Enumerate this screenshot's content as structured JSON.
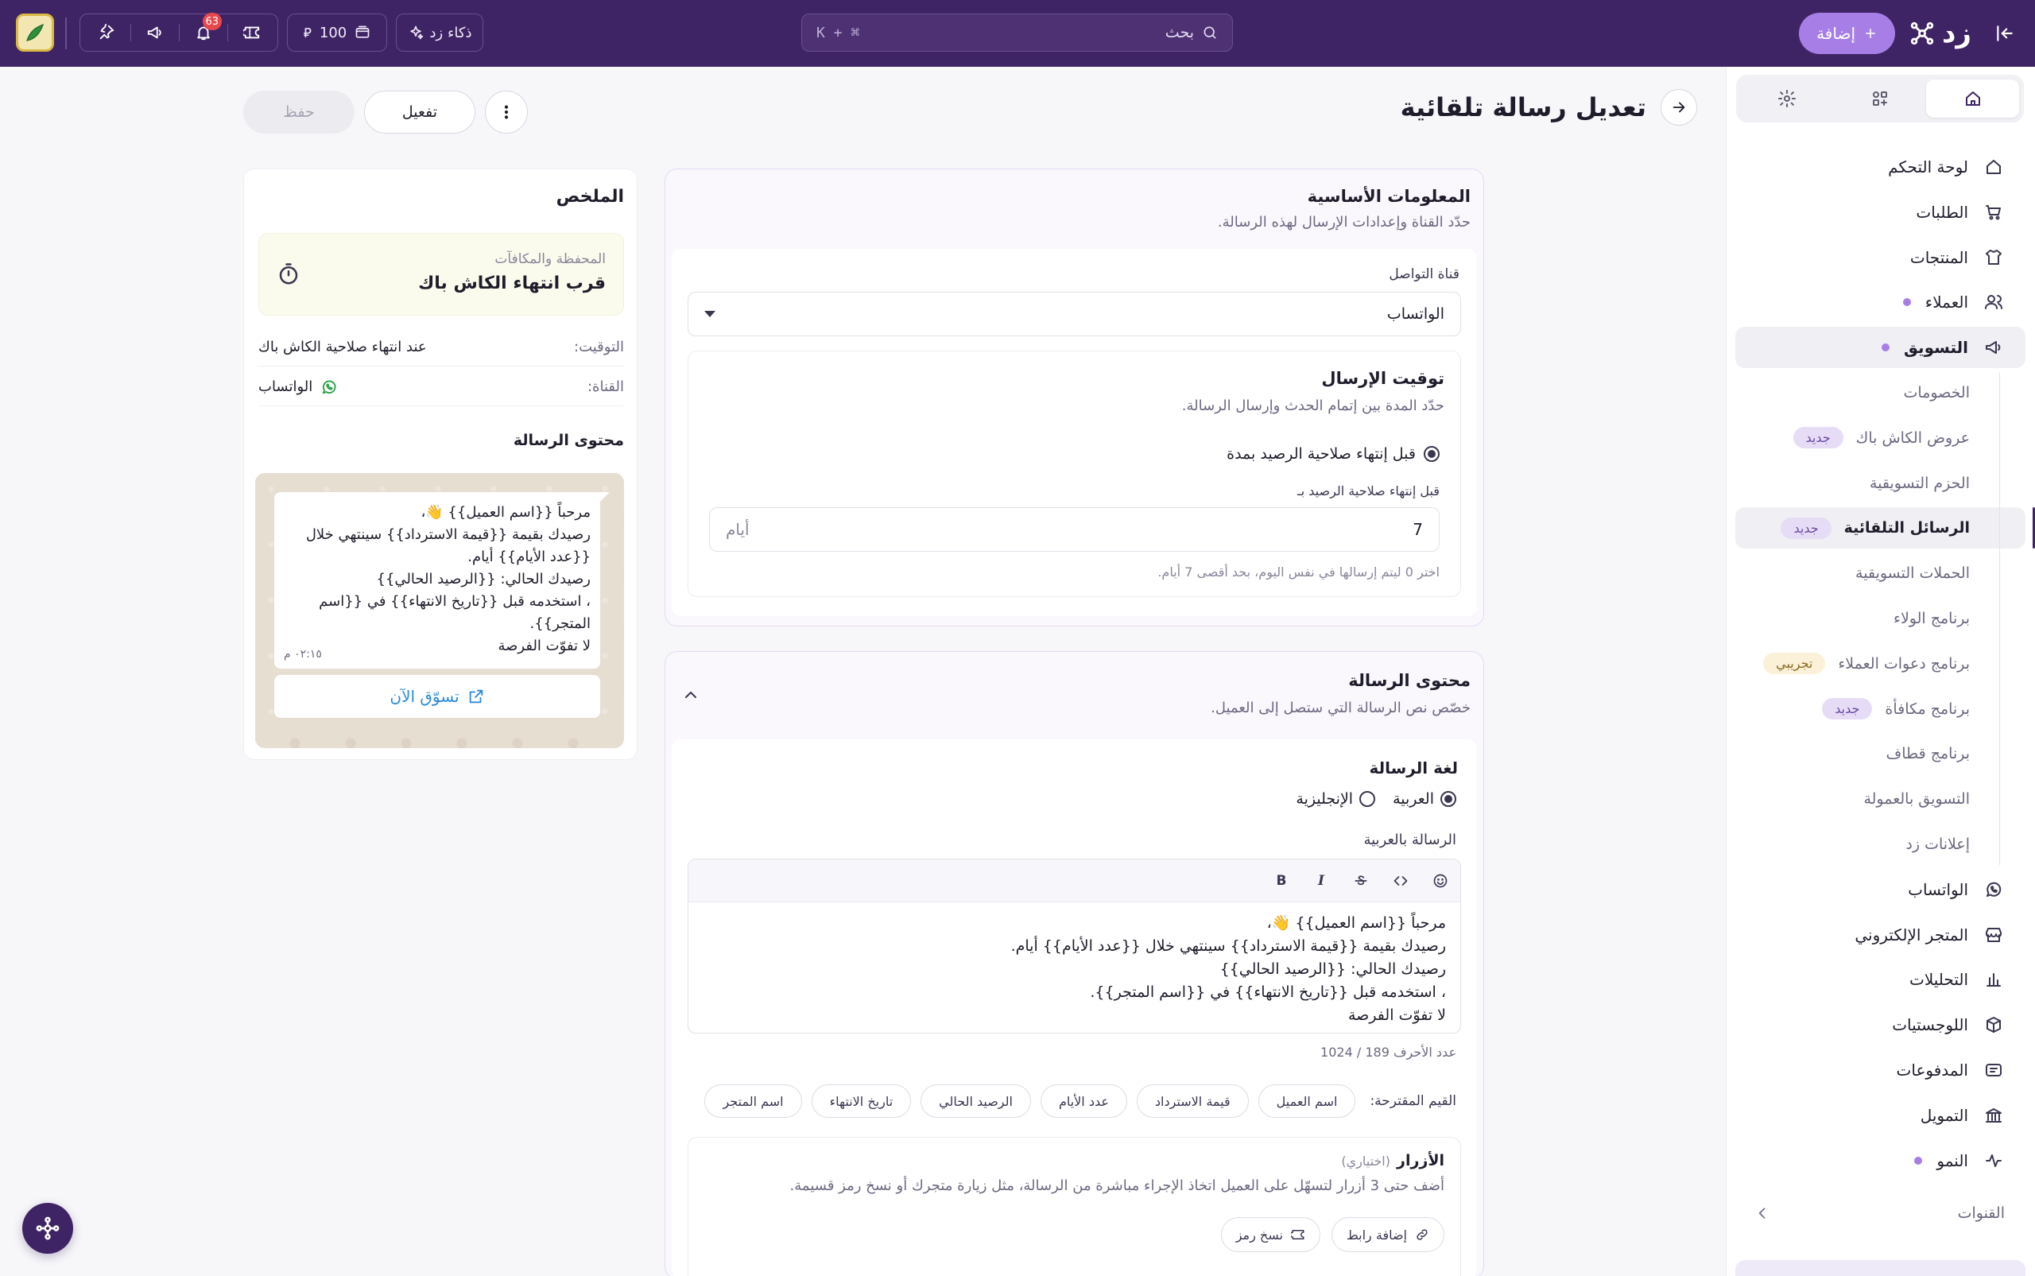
{
  "topbar": {
    "logo_text": "زد",
    "add_label": "إضافة",
    "search_placeholder": "بحث",
    "search_shortcut": "⌘ + K",
    "ai_label": "ذكاء زد",
    "balance": "100",
    "notifications_count": "63",
    "colors": {
      "bg": "#3f2465",
      "accent": "#a77ee6"
    }
  },
  "header": {
    "title": "تعديل رسالة تلقائية",
    "save_label": "حفظ",
    "activate_label": "تفعيل"
  },
  "sidebar": {
    "tabs": [
      "home-icon",
      "apps-icon",
      "settings-icon"
    ],
    "items": [
      {
        "label": "لوحة التحكم",
        "icon": "home-icon"
      },
      {
        "label": "الطلبات",
        "icon": "cart-icon"
      },
      {
        "label": "المنتجات",
        "icon": "shirt-icon"
      },
      {
        "label": "العملاء",
        "icon": "users-icon"
      },
      {
        "label": "التسويق",
        "icon": "megaphone-icon"
      }
    ],
    "marketing_sub": [
      {
        "label": "الخصومات"
      },
      {
        "label": "عروض الكاش باك",
        "badge": "جديد"
      },
      {
        "label": "الحزم التسويقية"
      },
      {
        "label": "الرسائل التلقائية",
        "badge": "جديد"
      },
      {
        "label": "الحملات التسويقية"
      },
      {
        "label": "برنامج الولاء"
      },
      {
        "label": "برنامج دعوات العملاء",
        "badge": "تجريبي"
      },
      {
        "label": "برنامج مكافأة",
        "badge": "جديد"
      },
      {
        "label": "برنامج قطاف"
      },
      {
        "label": "التسويق بالعمولة"
      },
      {
        "label": "إعلانات زد"
      }
    ],
    "items_after": [
      {
        "label": "الواتساب",
        "icon": "whatsapp-icon"
      },
      {
        "label": "المتجر الإلكتروني",
        "icon": "store-icon"
      },
      {
        "label": "التحليلات",
        "icon": "chart-icon"
      },
      {
        "label": "اللوجستيات",
        "icon": "box-icon"
      },
      {
        "label": "المدفوعات",
        "icon": "payments-icon"
      },
      {
        "label": "التمويل",
        "icon": "bank-icon"
      },
      {
        "label": "النمو",
        "icon": "pulse-icon"
      }
    ],
    "channels_label": "القنوات"
  },
  "basic_info": {
    "title": "المعلومات الأساسية",
    "subtitle": "حدّد القناة وإعدادات الإرسال لهذه الرسالة.",
    "channel_label": "قناة التواصل",
    "channel_value": "الواتساب",
    "timing": {
      "title": "توقيت الإرسال",
      "subtitle": "حدّد المدة بين إتمام الحدث وإرسال الرسالة.",
      "option_label": "قبل إنتهاء صلاحية الرصيد بمدة",
      "field_label": "قبل إنتهاء صلاحية الرصيد بـ",
      "value": "7",
      "unit": "أيام",
      "hint": "اختر 0 ليتم إرسالها في نفس اليوم، بحد أقصى 7 أيام."
    }
  },
  "message_content": {
    "title": "محتوى الرسالة",
    "subtitle": "خصّص نص الرسالة التي ستصل إلى العميل.",
    "language_title": "لغة الرسالة",
    "lang_ar": "العربية",
    "lang_en": "الإنجليزية",
    "editor_label": "الرسالة بالعربية",
    "toolbar": [
      "emoji-icon",
      "code-icon",
      "strike-icon",
      "italic-icon",
      "bold-icon"
    ],
    "body": "مرحباً {{اسم العميل}} 👋،\nرصيدك بقيمة {{قيمة الاسترداد}} سينتهي خلال {{عدد الأيام}} أيام.\nرصيدك الحالي: {{الرصيد الحالي}}\n، استخدمه قبل {{تاريخ الانتهاء}} في {{اسم المتجر}}.\nلا تفوّت الفرصة",
    "counter": "عدد الأحرف 189 / 1024",
    "suggested_label": "القيم المقترحة:",
    "chips": [
      "اسم العميل",
      "قيمة الاسترداد",
      "عدد الأيام",
      "الرصيد الحالي",
      "تاريخ الانتهاء",
      "اسم المتجر"
    ],
    "buttons_title": "الأزرار",
    "buttons_optional": "(اختياري)",
    "buttons_desc": "أضف حتى 3 أزرار لتسهّل على العميل اتخاذ الإجراء مباشرة من الرسالة، مثل زيارة متجرك أو نسخ رمز قسيمة.",
    "add_link_label": "إضافة رابط",
    "copy_code_label": "نسخ رمز"
  },
  "summary": {
    "title": "الملخص",
    "event_category": "المحفظة والمكافآت",
    "event_name": "قرب انتهاء الكاش باك",
    "timing_key": "التوقيت:",
    "timing_value": "عند انتهاء صلاحية الكاش باك",
    "channel_key": "القناة:",
    "channel_value": "الواتساب",
    "content_title": "محتوى الرسالة",
    "preview_body": "مرحباً {{اسم العميل}} 👋،\nرصيدك بقيمة {{قيمة الاسترداد}} سينتهي خلال {{عدد الأيام}} أيام.\nرصيدك الحالي: {{الرصيد الحالي}}\n، استخدمه قبل {{تاريخ الانتهاء}} في {{اسم المتجر}}.\nلا تفوّت الفرصة",
    "preview_time": "٠٢:١٥ م",
    "cta_label": "تسوّق الآن"
  }
}
